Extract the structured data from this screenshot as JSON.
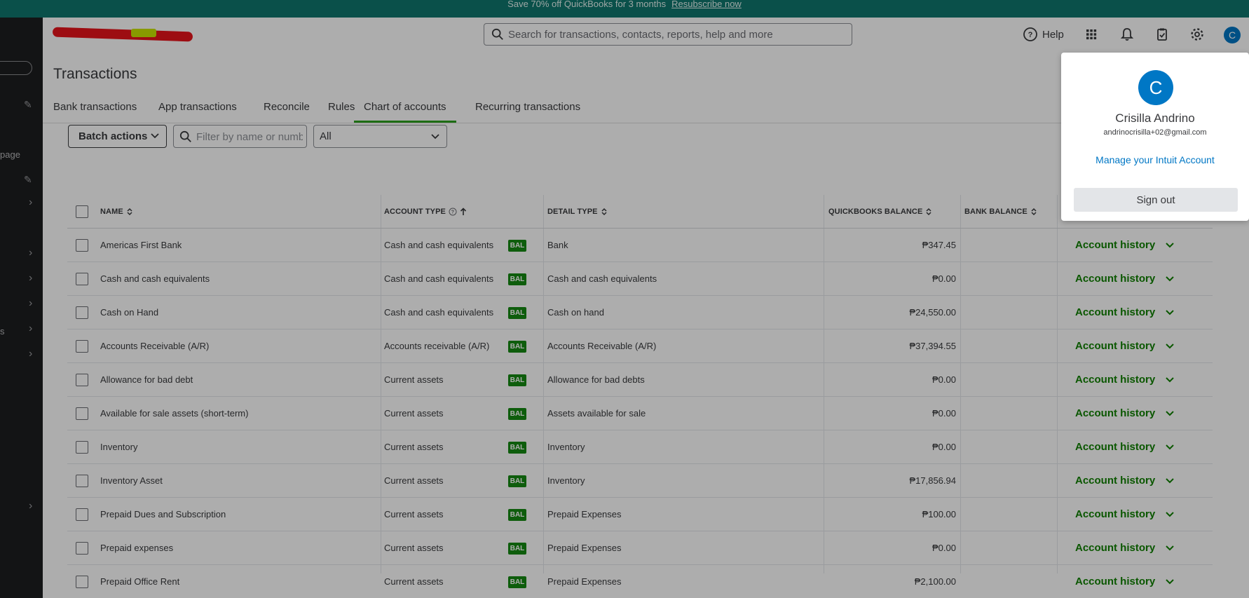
{
  "promo": {
    "text": "Save 70% off QuickBooks for 3 months",
    "link": "Resubscribe now"
  },
  "leftnav": {
    "partial_label": "page",
    "partial_label2": "s"
  },
  "header": {
    "search_placeholder": "Search for transactions, contacts, reports, help and more",
    "help_label": "Help",
    "avatar_initial": "C"
  },
  "page": {
    "title": "Transactions"
  },
  "tabs": [
    {
      "label": "Bank transactions"
    },
    {
      "label": "App transactions"
    },
    {
      "label": "Reconcile"
    },
    {
      "label": "Rules"
    },
    {
      "label": "Chart of accounts",
      "active": true
    },
    {
      "label": "Recurring transactions"
    }
  ],
  "toolbar": {
    "batch_label": "Batch actions",
    "filter_placeholder": "Filter by name or number",
    "type_select": "All"
  },
  "table": {
    "headers": {
      "name": "NAME",
      "account_type": "ACCOUNT TYPE",
      "detail_type": "DETAIL TYPE",
      "qb_balance": "QUICKBOOKS BALANCE",
      "bank_balance": "BANK BALANCE"
    },
    "badge": "BAL",
    "action_label": "Account history",
    "rows": [
      {
        "name": "Americas First Bank",
        "account_type": "Cash and cash equivalents",
        "detail_type": "Bank",
        "qb_balance": "₱347.45"
      },
      {
        "name": "Cash and cash equivalents",
        "account_type": "Cash and cash equivalents",
        "detail_type": "Cash and cash equivalents",
        "qb_balance": "₱0.00"
      },
      {
        "name": "Cash on Hand",
        "account_type": "Cash and cash equivalents",
        "detail_type": "Cash on hand",
        "qb_balance": "₱24,550.00"
      },
      {
        "name": "Accounts Receivable (A/R)",
        "account_type": "Accounts receivable (A/R)",
        "detail_type": "Accounts Receivable (A/R)",
        "qb_balance": "₱37,394.55"
      },
      {
        "name": "Allowance for bad debt",
        "account_type": "Current assets",
        "detail_type": "Allowance for bad debts",
        "qb_balance": "₱0.00"
      },
      {
        "name": "Available for sale assets (short-term)",
        "account_type": "Current assets",
        "detail_type": "Assets available for sale",
        "qb_balance": "₱0.00"
      },
      {
        "name": "Inventory",
        "account_type": "Current assets",
        "detail_type": "Inventory",
        "qb_balance": "₱0.00"
      },
      {
        "name": "Inventory Asset",
        "account_type": "Current assets",
        "detail_type": "Inventory",
        "qb_balance": "₱17,856.94"
      },
      {
        "name": "Prepaid Dues and Subscription",
        "account_type": "Current assets",
        "detail_type": "Prepaid Expenses",
        "qb_balance": "₱100.00"
      },
      {
        "name": "Prepaid expenses",
        "account_type": "Current assets",
        "detail_type": "Prepaid Expenses",
        "qb_balance": "₱0.00"
      },
      {
        "name": "Prepaid Office Rent",
        "account_type": "Current assets",
        "detail_type": "Prepaid Expenses",
        "qb_balance": "₱2,100.00"
      }
    ]
  },
  "popover": {
    "initial": "C",
    "name": "Crisilla Andrino",
    "email": "andrinocrisilla+02@gmail.com",
    "manage_link": "Manage your Intuit Account",
    "signout_label": "Sign out"
  },
  "colors": {
    "brand_green": "#2ca01c",
    "link_blue": "#0077c5",
    "banner_teal": "#0f766e",
    "badge_green": "#168a12"
  }
}
